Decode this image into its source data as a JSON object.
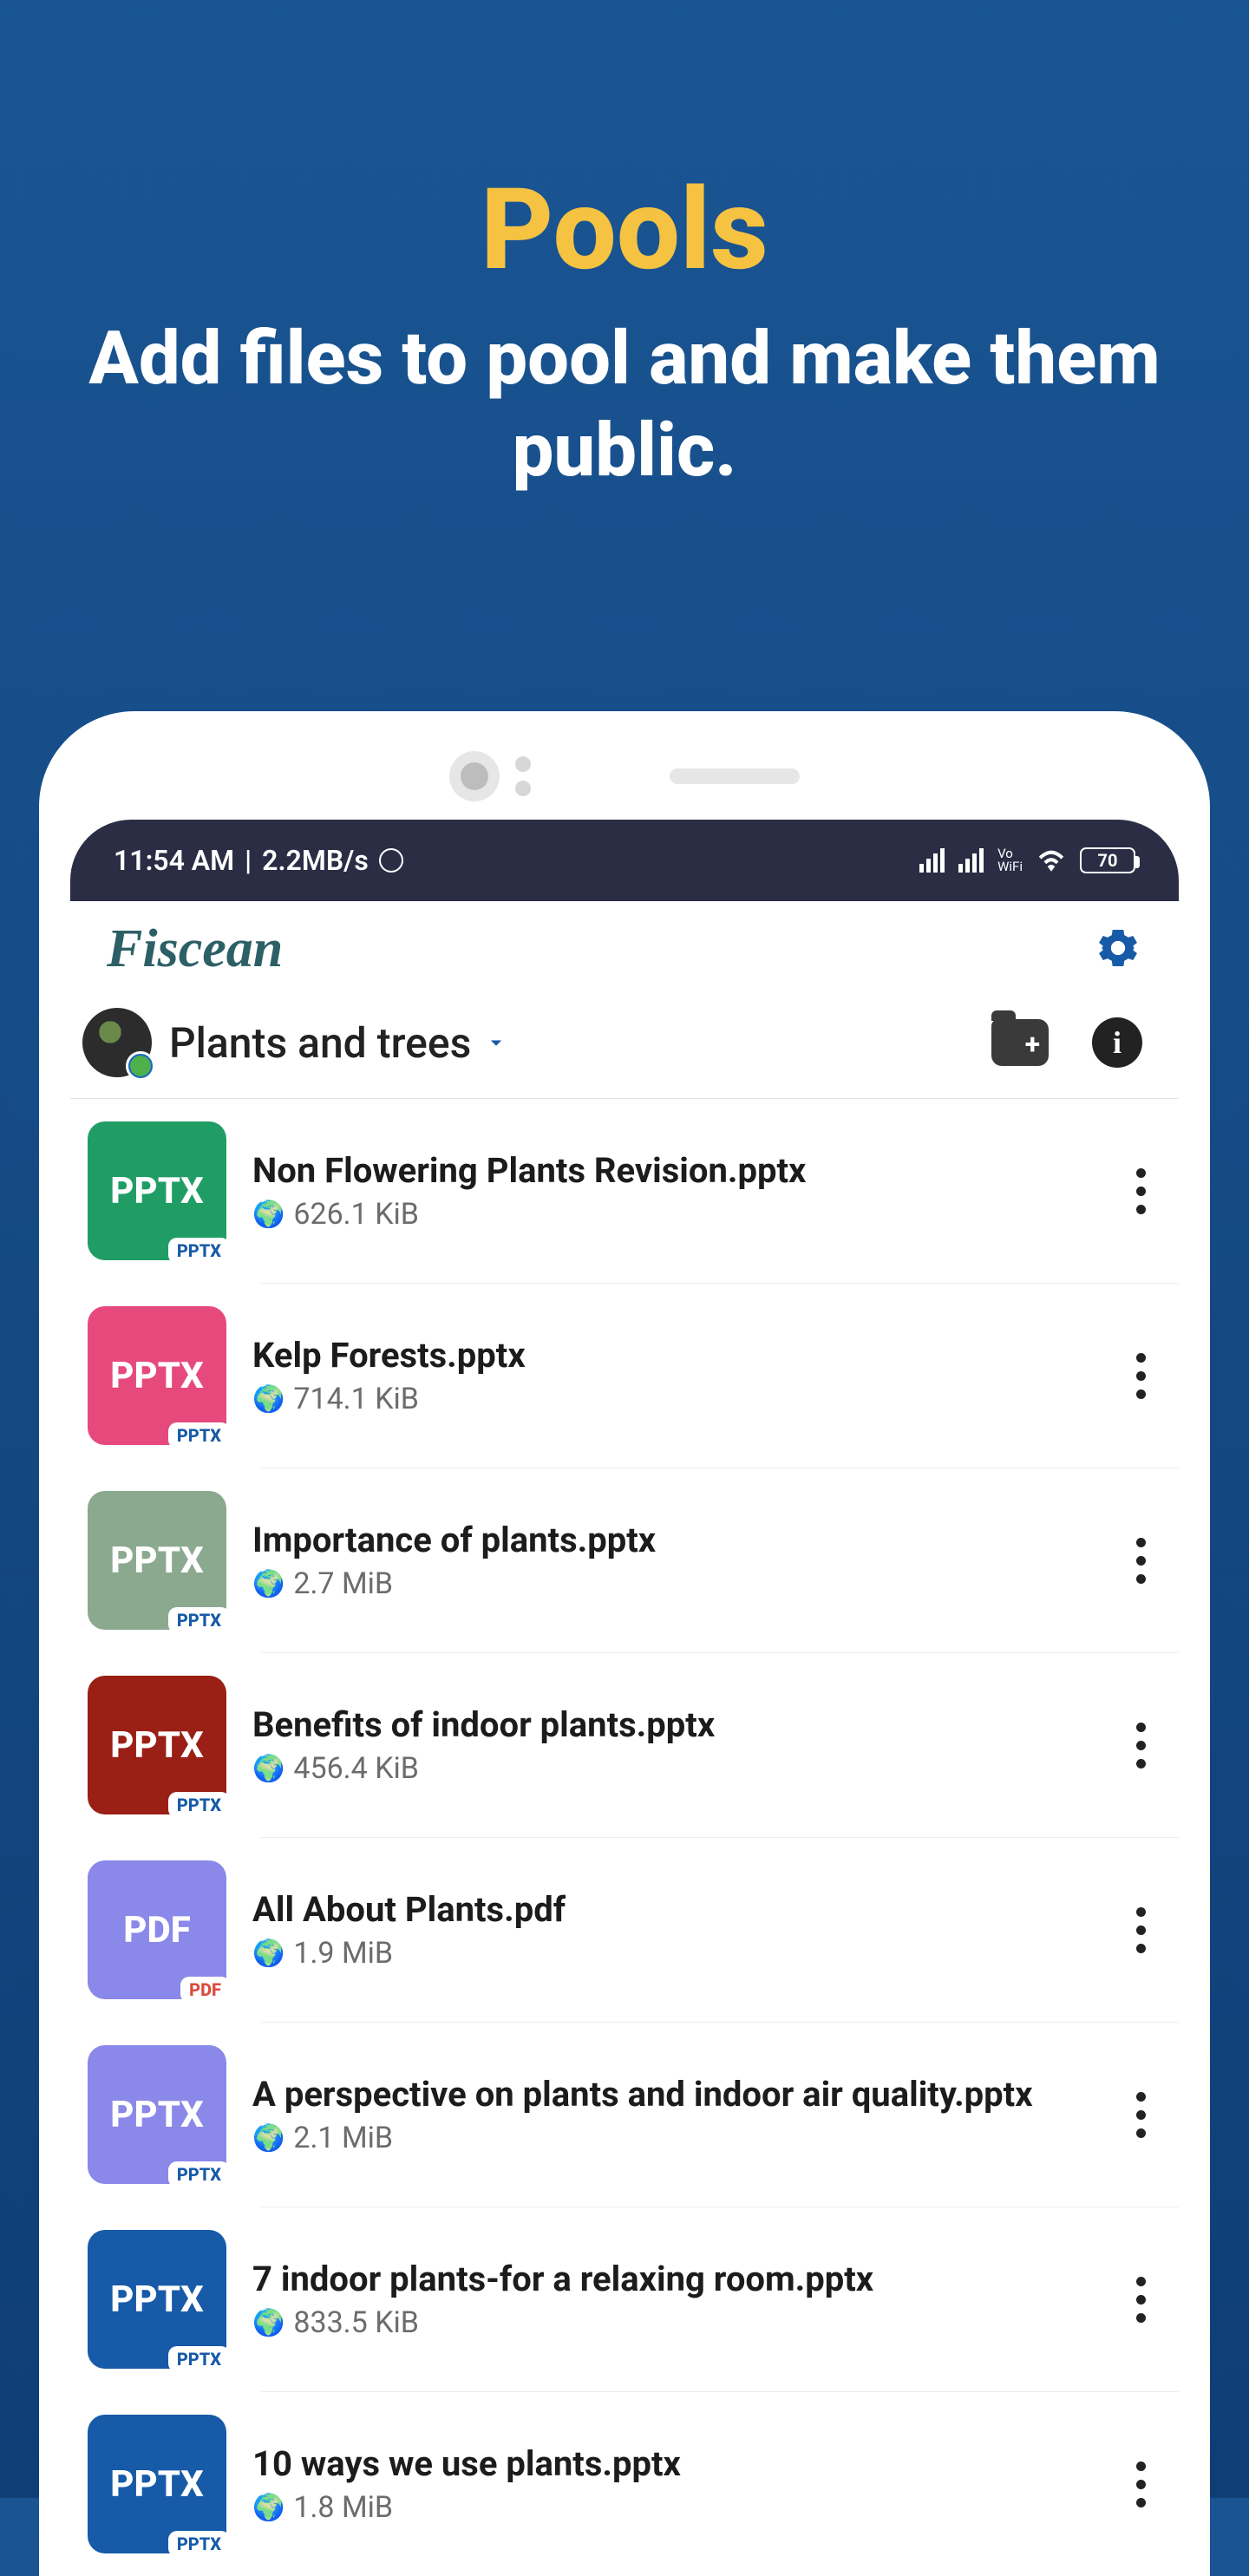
{
  "promo": {
    "title": "Pools",
    "subtitle": "Add files to pool and make them public."
  },
  "status": {
    "time": "11:54 AM",
    "speed": "2.2MB/s",
    "vowifi_top": "Vo",
    "vowifi_bottom": "WiFi",
    "battery": "70"
  },
  "app": {
    "brand": "Fiscean",
    "pool_name": "Plants and trees"
  },
  "files": [
    {
      "name": "Non Flowering Plants Revision.pptx",
      "size": "626.1 KiB",
      "type": "PPTX",
      "badge": "PPTX",
      "color": "#1f9d65"
    },
    {
      "name": "Kelp Forests.pptx",
      "size": "714.1 KiB",
      "type": "PPTX",
      "badge": "PPTX",
      "color": "#e64a7d"
    },
    {
      "name": "Importance of plants.pptx",
      "size": "2.7 MiB",
      "type": "PPTX",
      "badge": "PPTX",
      "color": "#8aa98f"
    },
    {
      "name": "Benefits of indoor plants.pptx",
      "size": "456.4 KiB",
      "type": "PPTX",
      "badge": "PPTX",
      "color": "#9a1f15"
    },
    {
      "name": "All About Plants.pdf",
      "size": "1.9 MiB",
      "type": "PDF",
      "badge": "PDF",
      "color": "#8a88e8"
    },
    {
      "name": "A perspective on plants and indoor air quality.pptx",
      "size": "2.1 MiB",
      "type": "PPTX",
      "badge": "PPTX",
      "color": "#8a88e8"
    },
    {
      "name": "7 indoor plants-for a relaxing room.pptx",
      "size": "833.5 KiB",
      "type": "PPTX",
      "badge": "PPTX",
      "color": "#175aa8"
    },
    {
      "name": "10 ways we use plants.pptx",
      "size": "1.8 MiB",
      "type": "PPTX",
      "badge": "PPTX",
      "color": "#175aa8"
    }
  ]
}
